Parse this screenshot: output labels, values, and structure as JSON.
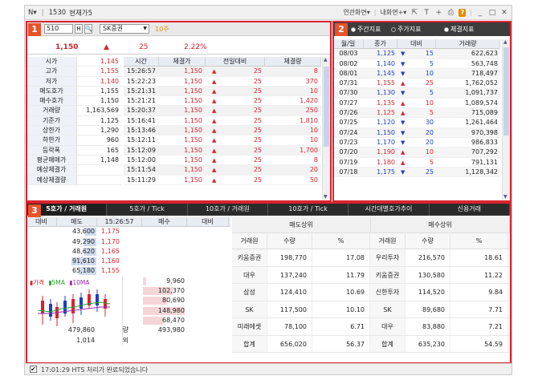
{
  "title": {
    "menu": "N",
    "code": "1530",
    "name": "현재가5",
    "linked": "연관화면",
    "trade": "내화면+"
  },
  "panel1": {
    "badge": "1",
    "code": "510",
    "btn_h": "H",
    "btn_q": "Q",
    "stock_name": "SK증권",
    "unit": "10주",
    "price": "1,150",
    "change": "25",
    "rate": "2.22%",
    "left_rows": [
      {
        "label": "시가",
        "value": "1,145",
        "color": "red"
      },
      {
        "label": "고가",
        "value": "1,155",
        "color": "red"
      },
      {
        "label": "저가",
        "value": "1,140",
        "color": "red"
      },
      {
        "label": "매도호가",
        "value": "1,155",
        "color": ""
      },
      {
        "label": "매수호가",
        "value": "1,150",
        "color": ""
      },
      {
        "label": "거래량",
        "value": "1,163,569",
        "color": ""
      },
      {
        "label": "기준가",
        "value": "1,125",
        "color": ""
      },
      {
        "label": "상한가",
        "value": "1,290",
        "color": ""
      },
      {
        "label": "하한가",
        "value": "960",
        "color": ""
      },
      {
        "label": "등락폭",
        "value": "165",
        "color": ""
      },
      {
        "label": "평균매매가",
        "value": "1,148",
        "color": ""
      },
      {
        "label": "예상체결가",
        "value": "",
        "color": ""
      },
      {
        "label": "예상체결량",
        "value": "",
        "color": ""
      }
    ],
    "tick_headers": [
      "시간",
      "체결가",
      "전일대비",
      "체결량"
    ],
    "ticks": [
      [
        "15:26:57",
        "1,150",
        "25",
        "8"
      ],
      [
        "15:22:23",
        "1,150",
        "25",
        "370"
      ],
      [
        "15:21:31",
        "1,150",
        "25",
        "10"
      ],
      [
        "15:21:21",
        "1,150",
        "25",
        "1,420"
      ],
      [
        "15:20:37",
        "1,150",
        "25",
        "250"
      ],
      [
        "15:16:41",
        "1,150",
        "25",
        "1,810"
      ],
      [
        "15:13:46",
        "1,150",
        "25",
        "10"
      ],
      [
        "15:12:11",
        "1,150",
        "25",
        "10"
      ],
      [
        "15:12:09",
        "1,150",
        "25",
        "1,700"
      ],
      [
        "15:12:00",
        "1,150",
        "25",
        "8"
      ],
      [
        "15:11:54",
        "1,150",
        "25",
        "20"
      ],
      [
        "15:11:29",
        "1,150",
        "25",
        "50"
      ]
    ]
  },
  "panel2": {
    "badge": "2",
    "radio": [
      "주간지표",
      "주가지표",
      "체결지표"
    ],
    "headers": [
      "월/일",
      "종가",
      "대비",
      "거래량"
    ],
    "rows": [
      [
        "08/03",
        "1,125",
        "down",
        "15",
        "622,623"
      ],
      [
        "08/02",
        "1,140",
        "down",
        "5",
        "563,748"
      ],
      [
        "08/01",
        "1,145",
        "down",
        "10",
        "718,497"
      ],
      [
        "07/31",
        "1,155",
        "up",
        "25",
        "1,762,052"
      ],
      [
        "07/30",
        "1,130",
        "down",
        "5",
        "1,091,737"
      ],
      [
        "07/27",
        "1,135",
        "up",
        "10",
        "1,089,574"
      ],
      [
        "07/26",
        "1,125",
        "up",
        "5",
        "715,089"
      ],
      [
        "07/25",
        "1,120",
        "down",
        "30",
        "1,261,464"
      ],
      [
        "07/24",
        "1,150",
        "down",
        "20",
        "970,398"
      ],
      [
        "07/23",
        "1,170",
        "down",
        "20",
        "986,833"
      ],
      [
        "07/20",
        "1,190",
        "up",
        "10",
        "707,292"
      ],
      [
        "07/19",
        "1,180",
        "up",
        "5",
        "791,131"
      ],
      [
        "07/18",
        "1,175",
        "down",
        "25",
        "1,128,342"
      ]
    ]
  },
  "panel3": {
    "badge": "3",
    "tabs": [
      "5호가 / 거래원",
      "5호가 / Tick",
      "10호가 / 거래원",
      "10호가 / Tick",
      "시간대별호가추이",
      "신용거래"
    ],
    "hoga_headers": [
      "대비",
      "매도",
      "15:26:57",
      "매수",
      "대비"
    ],
    "asks": [
      {
        "qty": "43,600",
        "price": "1,175",
        "w": 0.3
      },
      {
        "qty": "49,290",
        "price": "1,170",
        "w": 0.34
      },
      {
        "qty": "48,620",
        "price": "1,165",
        "w": 0.33
      },
      {
        "qty": "91,610",
        "price": "1,160",
        "w": 0.65
      },
      {
        "qty": "65,180",
        "price": "1,155",
        "w": 0.46
      }
    ],
    "bids": [
      {
        "price": "1,150",
        "qty": "9,960",
        "w": 0.07
      },
      {
        "price": "1,145",
        "qty": "102,370",
        "w": 0.72
      },
      {
        "price": "1,140",
        "qty": "80,690",
        "w": 0.57
      },
      {
        "price": "1,135",
        "qty": "148,980",
        "w": 1.0
      },
      {
        "price": "1,130",
        "qty": "68,470",
        "w": 0.48
      }
    ],
    "legend": [
      "가격",
      "5MA",
      "10MA"
    ],
    "total_ask": "479,860",
    "total_label": "총잔량",
    "total_bid": "493,980",
    "after_qty": "1,014",
    "after_label": "시간외",
    "sell_title": "매도상위",
    "buy_title": "매수상위",
    "sub_headers": [
      "거래원",
      "수량",
      "%",
      "거래원",
      "수량",
      "%"
    ],
    "brokers": [
      [
        "키움증권",
        "198,770",
        "17.08",
        "우리투자",
        "216,570",
        "18.61"
      ],
      [
        "대우",
        "137,240",
        "11.79",
        "키움증권",
        "130,580",
        "11.22"
      ],
      [
        "삼성",
        "124,410",
        "10.69",
        "신한투자",
        "114,520",
        "9.84"
      ],
      [
        "SK",
        "117,500",
        "10.10",
        "SK",
        "89,680",
        "7.71"
      ],
      [
        "미래에셋",
        "78,100",
        "6.71",
        "대우",
        "83,880",
        "7.21"
      ],
      [
        "합계",
        "656,020",
        "56.37",
        "합계",
        "635,230",
        "54.59"
      ]
    ]
  },
  "status": {
    "time": "17:01:29",
    "message": "HTS 처리가 완료되었습니다"
  },
  "colors": {
    "red": "#d9232e",
    "blue": "#1f3fbf",
    "frame": "#d9232e",
    "badge": "#e5542a"
  }
}
